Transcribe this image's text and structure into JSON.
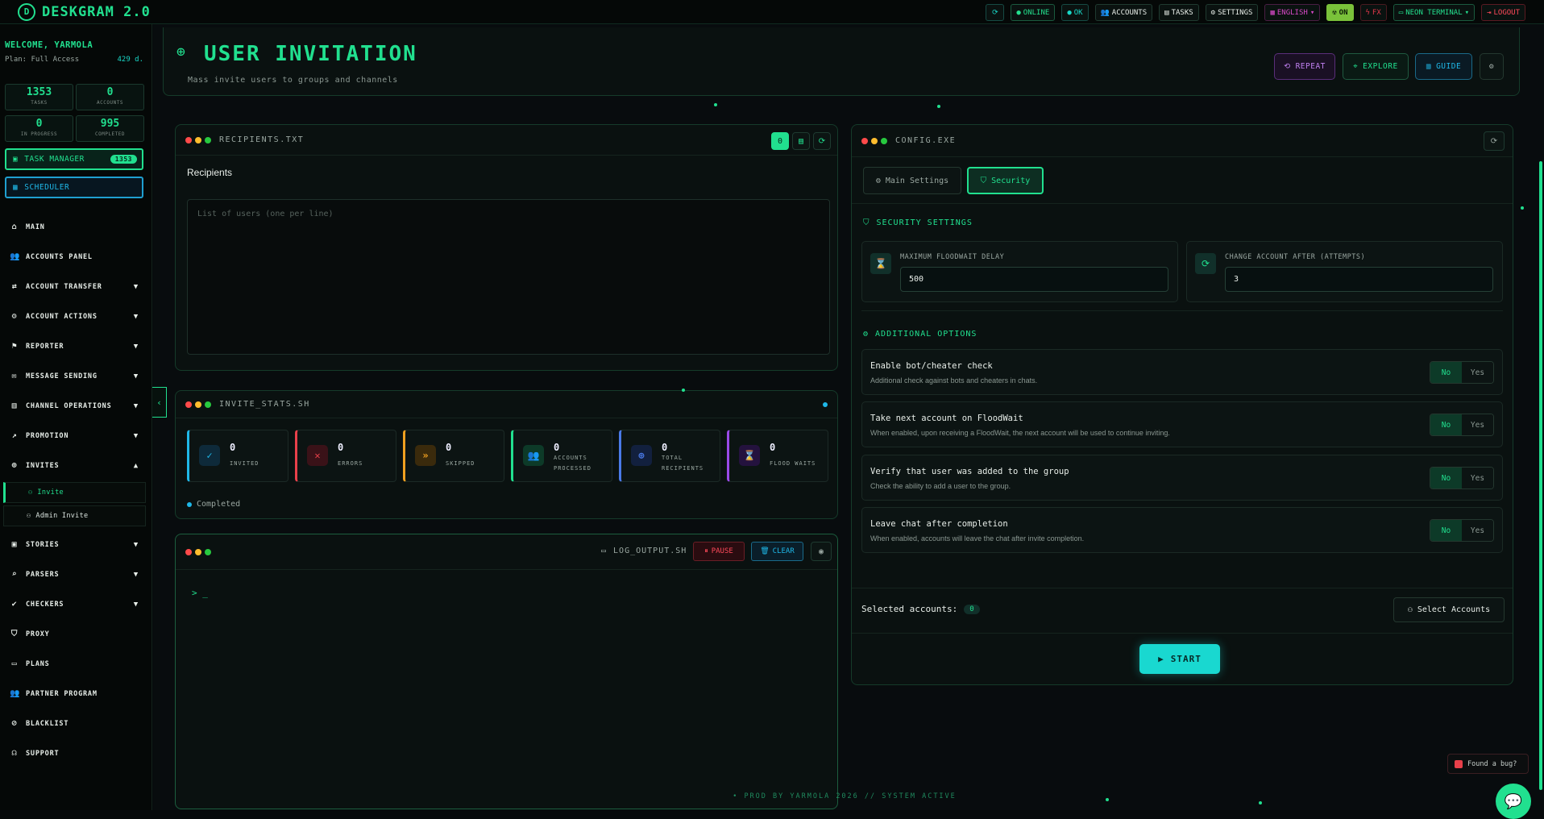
{
  "app": {
    "name": "DESKGRAM 2.0"
  },
  "topbar": {
    "online": "ONLINE",
    "ok": "OK",
    "accounts": "ACCOUNTS",
    "tasks": "TASKS",
    "settings": "SETTINGS",
    "language": "ENGLISH",
    "on": "ON",
    "fx": "FX",
    "theme": "NEON TERMINAL",
    "logout": "LOGOUT"
  },
  "sidebar": {
    "welcome": "WELCOME, YARMOLA",
    "plan": "Plan: Full Access",
    "days": "429 d.",
    "stats": [
      {
        "value": "1353",
        "label": "TASKS"
      },
      {
        "value": "0",
        "label": "ACCOUNTS"
      },
      {
        "value": "0",
        "label": "IN PROGRESS"
      },
      {
        "value": "995",
        "label": "COMPLETED"
      }
    ],
    "task_manager": "TASK MANAGER",
    "task_manager_badge": "1353",
    "scheduler": "SCHEDULER",
    "items": [
      {
        "label": "MAIN"
      },
      {
        "label": "ACCOUNTS PANEL"
      },
      {
        "label": "ACCOUNT TRANSFER"
      },
      {
        "label": "ACCOUNT ACTIONS"
      },
      {
        "label": "REPORTER"
      },
      {
        "label": "MESSAGE SENDING"
      },
      {
        "label": "CHANNEL OPERATIONS"
      },
      {
        "label": "PROMOTION"
      },
      {
        "label": "INVITES"
      },
      {
        "label": "STORIES"
      },
      {
        "label": "PARSERS"
      },
      {
        "label": "CHECKERS"
      },
      {
        "label": "PROXY"
      },
      {
        "label": "PLANS"
      },
      {
        "label": "PARTNER PROGRAM"
      },
      {
        "label": "BLACKLIST"
      },
      {
        "label": "SUPPORT"
      }
    ],
    "sub_items": [
      {
        "label": "Invite"
      },
      {
        "label": "Admin Invite"
      }
    ]
  },
  "header": {
    "title": "USER INVITATION",
    "subtitle": "Mass invite users to groups and channels",
    "repeat": "REPEAT",
    "explore": "EXPLORE",
    "guide": "GUIDE"
  },
  "recipients": {
    "window_title": "RECIPIENTS.TXT",
    "label": "Recipients",
    "placeholder": "List of users (one per line)"
  },
  "invite_stats": {
    "window_title": "INVITE_STATS.SH",
    "status": "Completed",
    "cards": [
      {
        "value": "0",
        "label": "INVITED",
        "color": "#1fb8e8"
      },
      {
        "value": "0",
        "label": "ERRORS",
        "color": "#e8404a"
      },
      {
        "value": "0",
        "label": "SKIPPED",
        "color": "#f0a020"
      },
      {
        "value": "0",
        "label": "ACCOUNTS PROCESSED",
        "color": "#21e08f"
      },
      {
        "value": "0",
        "label": "TOTAL RECIPIENTS",
        "color": "#4a7ae8"
      },
      {
        "value": "0",
        "label": "FLOOD WAITS",
        "color": "#9a4ae8"
      }
    ]
  },
  "log": {
    "window_title": "LOG_OUTPUT.SH",
    "pause": "PAUSE",
    "clear": "CLEAR",
    "prompt": "> _"
  },
  "config": {
    "window_title": "CONFIG.EXE",
    "tab_main": "Main Settings",
    "tab_security": "Security",
    "security_title": "SECURITY SETTINGS",
    "floodwait_label": "MAXIMUM FLOODWAIT DELAY",
    "floodwait_value": "500",
    "change_label": "CHANGE ACCOUNT AFTER (ATTEMPTS)",
    "change_value": "3",
    "additional_title": "ADDITIONAL OPTIONS",
    "options": [
      {
        "title": "Enable bot/cheater check",
        "desc": "Additional check against bots and cheaters in chats.",
        "no": "No",
        "yes": "Yes"
      },
      {
        "title": "Take next account on FloodWait",
        "desc": "When enabled, upon receiving a FloodWait, the next account will be used to continue inviting.",
        "no": "No",
        "yes": "Yes"
      },
      {
        "title": "Verify that user was added to the group",
        "desc": "Check the ability to add a user to the group.",
        "no": "No",
        "yes": "Yes"
      },
      {
        "title": "Leave chat after completion",
        "desc": "When enabled, accounts will leave the chat after invite completion.",
        "no": "No",
        "yes": "Yes"
      }
    ],
    "selected_label": "Selected accounts:",
    "selected_count": "0",
    "select_accounts": "Select Accounts",
    "start": "START"
  },
  "footer": {
    "text": "• PROD BY YARMOLA 2026   // SYSTEM ACTIVE"
  },
  "bug": {
    "label": "Found a bug?"
  },
  "colors": {
    "accent": "#21e08f",
    "teal": "#19d8c8",
    "bg": "#080c0e"
  }
}
